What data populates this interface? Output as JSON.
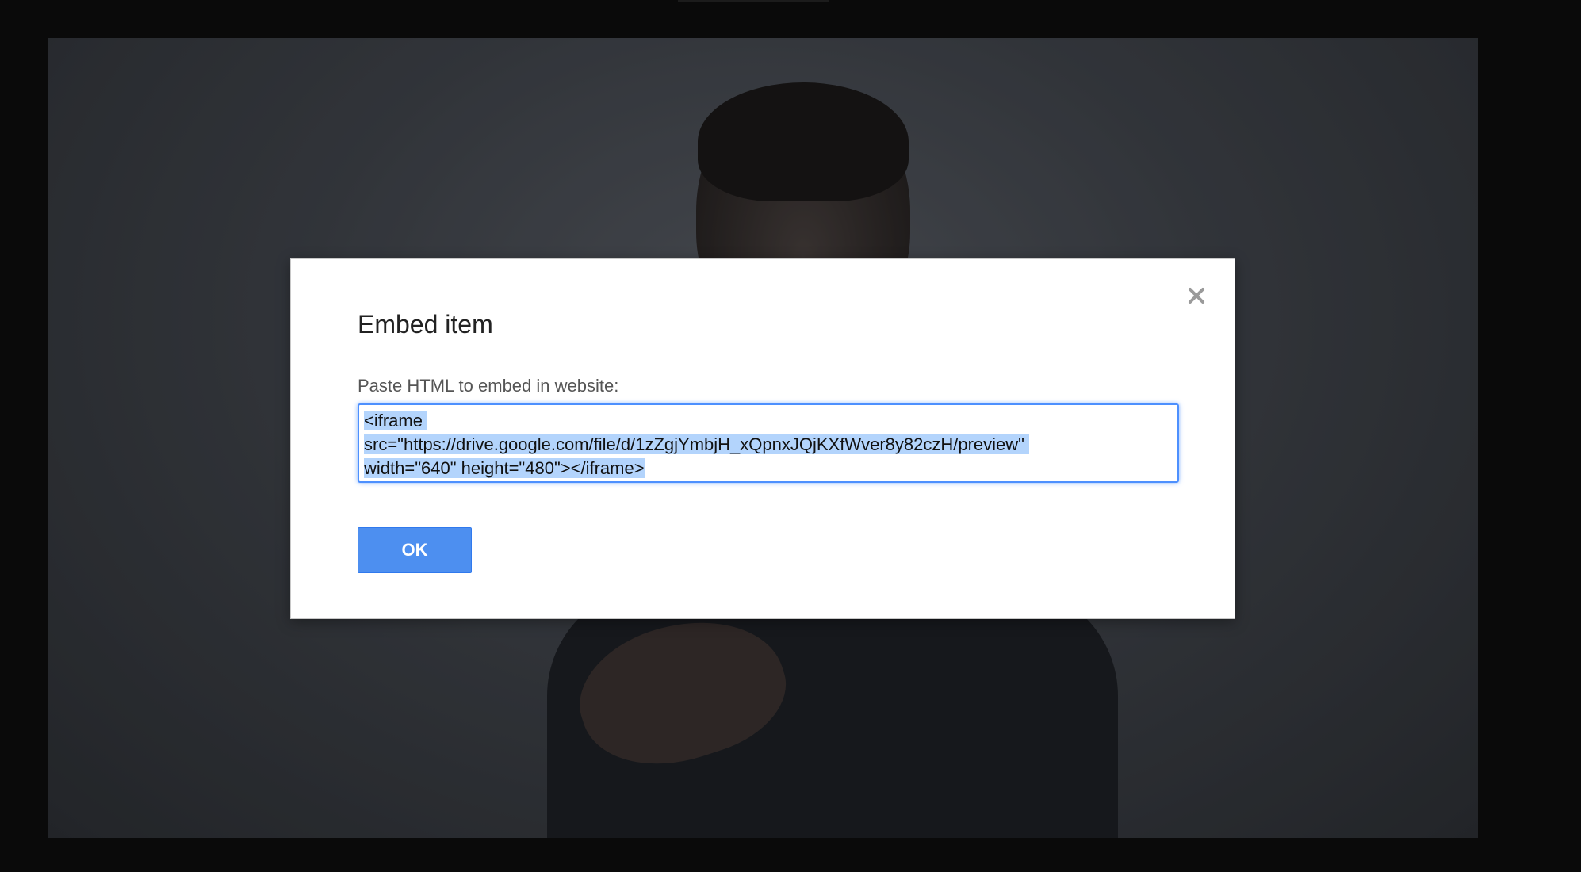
{
  "dialog": {
    "title": "Embed item",
    "label": "Paste HTML to embed in website:",
    "embed_code_line1": "<iframe ",
    "embed_code_line2": "src=\"https://drive.google.com/file/d/1zZgjYmbjH_xQpnxJQjKXfWver8y82czH/preview\" ",
    "embed_code_line3": "width=\"640\" height=\"480\"></iframe>",
    "ok_label": "OK",
    "close_icon": "close-icon"
  },
  "colors": {
    "accent": "#4d8ff0",
    "focus_ring": "#4d90fe",
    "selection": "#b3d4fc",
    "backdrop": "#0a0a0a"
  }
}
